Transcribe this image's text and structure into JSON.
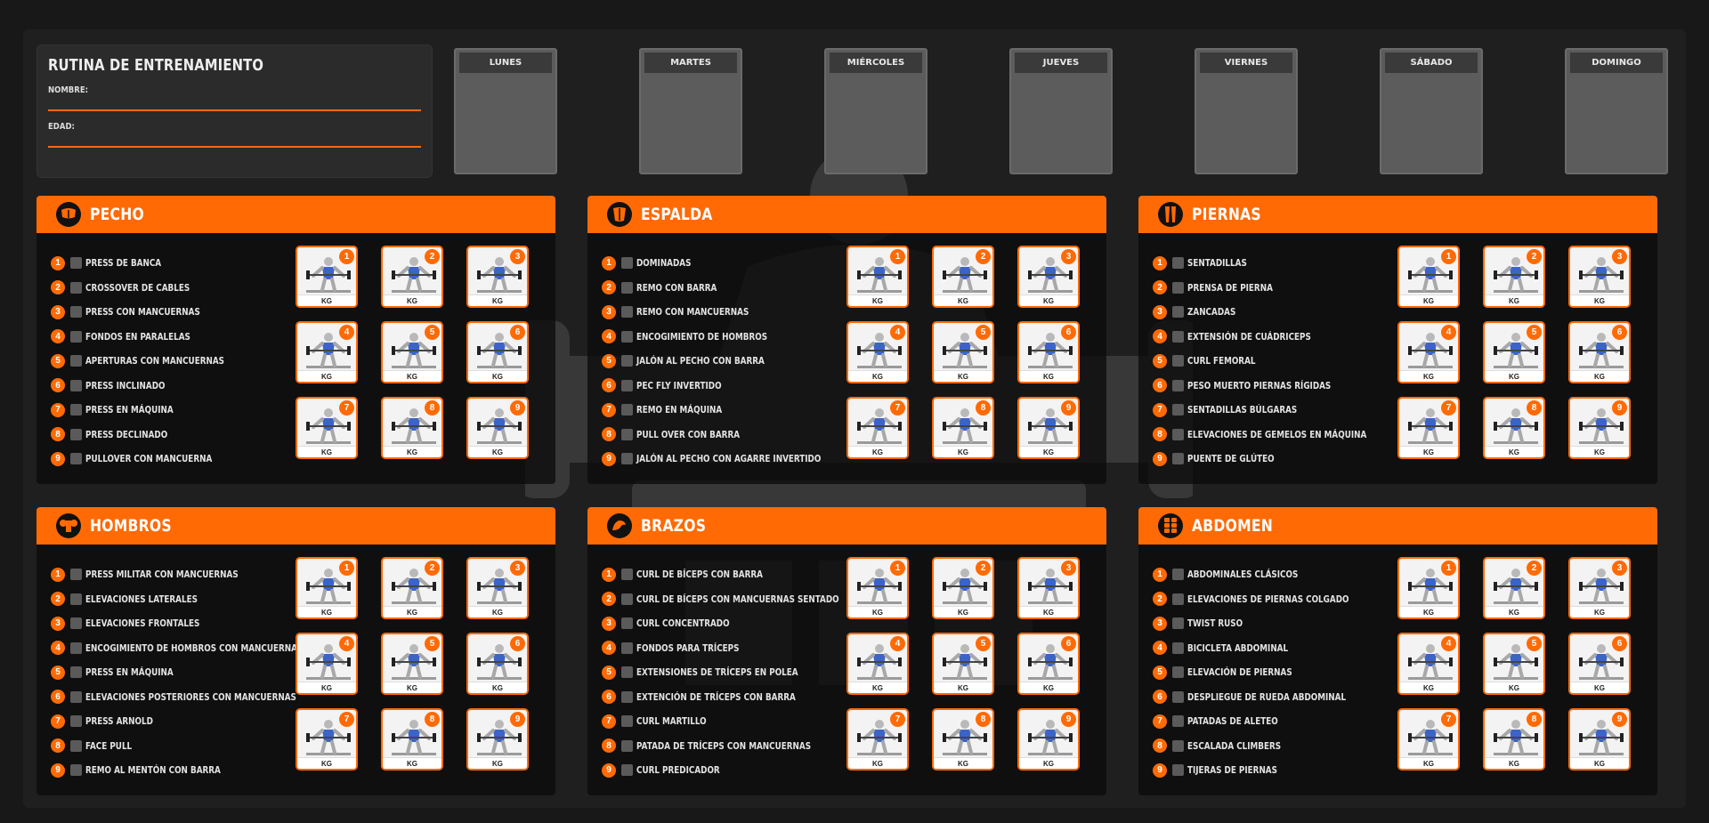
{
  "header": {
    "title": "RUTINA DE ENTRENAMIENTO",
    "name_label": "NOMBRE:",
    "age_label": "EDAD:"
  },
  "days": [
    "LUNES",
    "MARTES",
    "MIÉRCOLES",
    "JUEVES",
    "VIERNES",
    "SÁBADO",
    "DOMINGO"
  ],
  "kg_label": "KG",
  "colors": {
    "accent": "#ff6a05",
    "background": "#1f1f1f",
    "muscle": "#3c64c8"
  },
  "panels": [
    {
      "id": "pecho",
      "title": "PECHO",
      "icon": "chest-icon",
      "exercises": [
        "PRESS DE BANCA",
        "CROSSOVER DE CABLES",
        "PRESS CON MANCUERNAS",
        "FONDOS EN PARALELAS",
        "APERTURAS CON MANCUERNAS",
        "PRESS INCLINADO",
        "PRESS EN MÁQUINA",
        "PRESS DECLINADO",
        "PULLOVER CON MANCUERNA"
      ]
    },
    {
      "id": "espalda",
      "title": "ESPALDA",
      "icon": "back-icon",
      "exercises": [
        "DOMINADAS",
        "REMO CON BARRA",
        "REMO CON MANCUERNAS",
        "ENCOGIMIENTO DE HOMBROS",
        "JALÓN AL PECHO CON BARRA",
        "PEC FLY INVERTIDO",
        "REMO EN MÁQUINA",
        "PULL OVER CON BARRA",
        "JALÓN AL PECHO CON AGARRE INVERTIDO"
      ]
    },
    {
      "id": "piernas",
      "title": "PIERNAS",
      "icon": "legs-icon",
      "exercises": [
        "SENTADILLAS",
        "PRENSA DE PIERNA",
        "ZANCADAS",
        "EXTENSIÓN DE CUÁDRICEPS",
        "CURL FEMORAL",
        "PESO MUERTO PIERNAS RÍGIDAS",
        "SENTADILLAS BÚLGARAS",
        "ELEVACIONES DE GEMELOS EN MÁQUINA",
        "PUENTE DE GLÚTEO"
      ]
    },
    {
      "id": "hombros",
      "title": "HOMBROS",
      "icon": "shoulders-icon",
      "exercises": [
        "PRESS MILITAR CON MANCUERNAS",
        "ELEVACIONES LATERALES",
        "ELEVACIONES FRONTALES",
        "ENCOGIMIENTO DE HOMBROS CON MANCUERNAS",
        "PRESS EN MÁQUINA",
        "ELEVACIONES POSTERIORES CON MANCUERNAS",
        "PRESS ARNOLD",
        "FACE PULL",
        "REMO AL MENTÓN CON BARRA"
      ]
    },
    {
      "id": "brazos",
      "title": "BRAZOS",
      "icon": "arm-icon",
      "exercises": [
        "CURL DE BÍCEPS CON BARRA",
        "CURL DE BÍCEPS CON MANCUERNAS SENTADO",
        "CURL CONCENTRADO",
        "FONDOS PARA TRÍCEPS",
        "EXTENSIONES DE TRÍCEPS EN POLEA",
        "EXTENCIÓN DE TRÍCEPS CON BARRA",
        "CURL MARTILLO",
        "PATADA DE TRÍCEPS CON MANCUERNAS",
        "CURL PREDICADOR"
      ]
    },
    {
      "id": "abdomen",
      "title": "ABDOMEN",
      "icon": "abs-icon",
      "exercises": [
        "ABDOMINALES CLÁSICOS",
        "ELEVACIONES DE PIERNAS COLGADO",
        "TWIST RUSO",
        "BICICLETA ABDOMINAL",
        "ELEVACIÓN DE PIERNAS",
        "DESPLIEGUE DE RUEDA ABDOMINAL",
        "PATADAS DE ALETEO",
        "ESCALADA CLIMBERS",
        "TIJERAS DE PIERNAS"
      ]
    }
  ]
}
